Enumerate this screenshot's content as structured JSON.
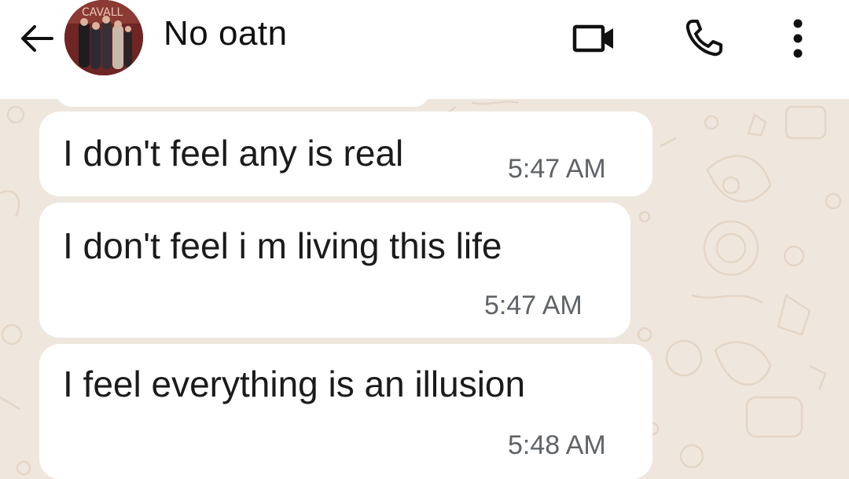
{
  "header": {
    "contact_name": "No oatn",
    "icons": {
      "back": "back-arrow-icon",
      "video": "video-call-icon",
      "call": "phone-call-icon",
      "menu": "more-vertical-icon"
    }
  },
  "messages": [
    {
      "text": "I don't feel any is real",
      "time": "5:47 AM"
    },
    {
      "text": "I don't feel i m living this life",
      "time": "5:47 AM"
    },
    {
      "text": "I feel everything is an illusion",
      "time": "5:48 AM"
    }
  ],
  "colors": {
    "header_bg": "#ffffff",
    "chat_bg": "#efe7de",
    "bubble_bg": "#ffffff",
    "text": "#1b1b1b",
    "timestamp": "#5f6368"
  }
}
